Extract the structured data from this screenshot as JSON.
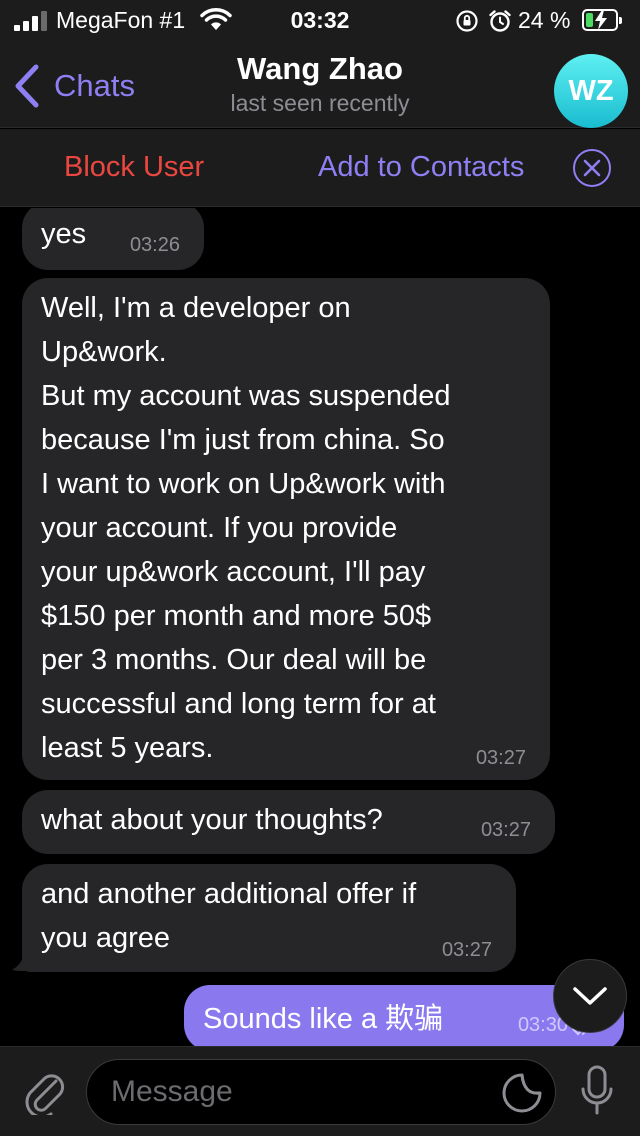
{
  "status_bar": {
    "carrier": "MegaFon #1",
    "time": "03:32",
    "battery": "24 %"
  },
  "header": {
    "back_label": "Chats",
    "title": "Wang Zhao",
    "subtitle": "last seen recently",
    "avatar_initials": "WZ",
    "avatar_color": "#2bcfe0"
  },
  "action_bar": {
    "block_label": "Block User",
    "add_label": "Add to Contacts"
  },
  "messages": [
    {
      "direction": "in",
      "text": "yes",
      "time": "03:26"
    },
    {
      "direction": "in",
      "text": "Well, I'm a developer on\nUp&work.\nBut my account was suspended\nbecause I'm just from china. So\nI want to work on Up&work with\nyour account. If you provide\nyour up&work account, I'll pay\n$150 per month and more 50$\nper 3 months. Our deal will be\nsuccessful and long term for at\nleast 5 years.",
      "time": "03:27"
    },
    {
      "direction": "in",
      "text": "what about your thoughts?",
      "time": "03:27"
    },
    {
      "direction": "in",
      "text": "and another additional offer if\nyou agree",
      "time": "03:27"
    },
    {
      "direction": "out",
      "text": "Sounds like a 欺骗",
      "time": "03:30"
    }
  ],
  "composer": {
    "placeholder": "Message"
  },
  "colors": {
    "accent": "#8e7ff2",
    "danger": "#e9473f",
    "outgoing_bubble": "#8a78ef",
    "incoming_bubble": "#262628"
  }
}
